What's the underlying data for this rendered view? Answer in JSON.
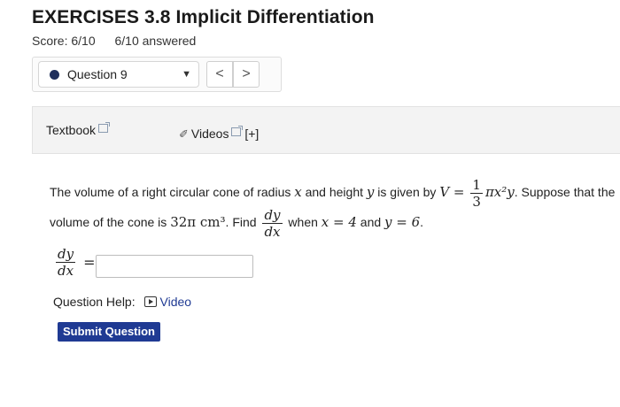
{
  "header": {
    "title": "EXERCISES 3.8 Implicit Differentiation",
    "score": "Score: 6/10",
    "answered": "6/10 answered"
  },
  "question_nav": {
    "selected": "Question 9",
    "prev_label": "<",
    "next_label": ">"
  },
  "resources": {
    "textbook": "Textbook",
    "videos": "Videos",
    "more": "[+]"
  },
  "problem": {
    "text1": "The volume of a right circular cone of radius",
    "var_x": "x",
    "text2": "and height",
    "var_y": "y",
    "text3": "is given by",
    "formula_lhs": "V =",
    "formula_num": "1",
    "formula_den": "3",
    "formula_rhs": "πx²y",
    "text4": ". Suppose that the",
    "text5": "volume of the cone is",
    "volume": "32π cm³",
    "text6": ". Find",
    "dy": "dy",
    "dx": "dx",
    "text7": "when",
    "cond_x": "x = 4",
    "text8": "and",
    "cond_y": "y = 6",
    "text9": "."
  },
  "answer": {
    "lhs_num": "dy",
    "lhs_den": "dx",
    "equals": "=",
    "value": ""
  },
  "help": {
    "label": "Question Help:",
    "video": "Video"
  },
  "submit": {
    "label": "Submit Question"
  },
  "colors": {
    "accent": "#1f3a93",
    "dot": "#1f2f5c"
  }
}
